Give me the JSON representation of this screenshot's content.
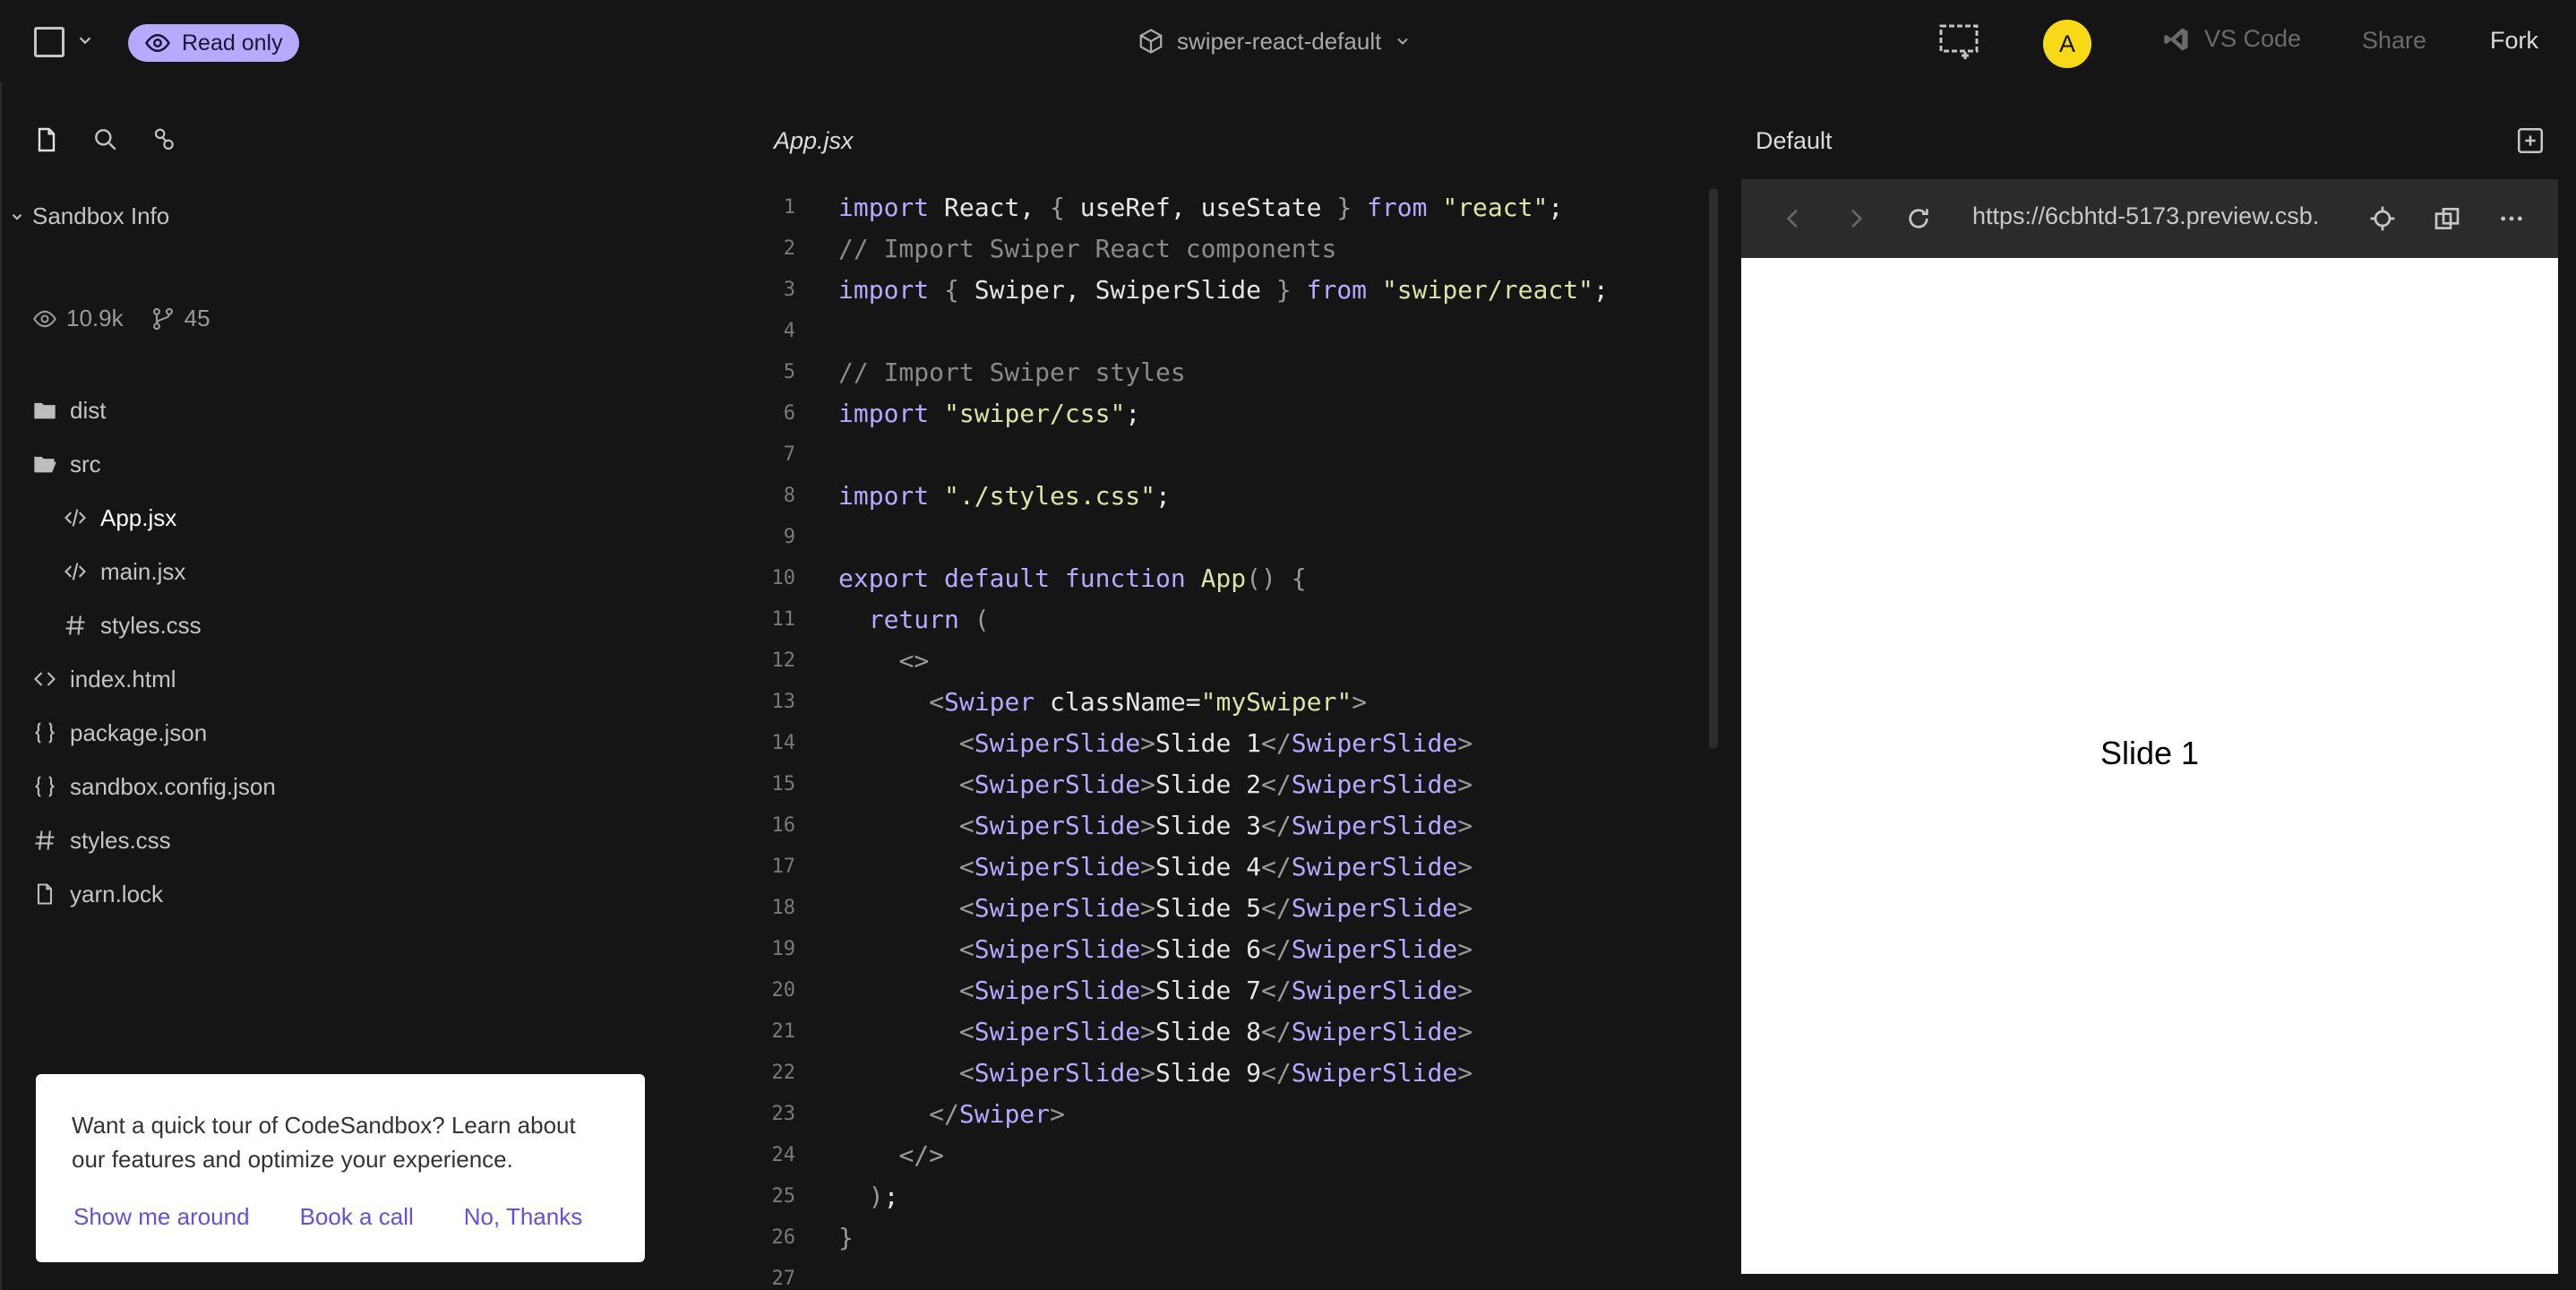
{
  "topbar": {
    "read_only_label": "Read only",
    "sandbox_name": "swiper-react-default",
    "avatar_initial": "A",
    "vscode_label": "VS Code",
    "share_label": "Share",
    "fork_label": "Fork",
    "readonly_bg": "#b8a9ff",
    "avatar_bg": "#f7d917"
  },
  "sidebar": {
    "section_title": "Sandbox Info",
    "views": "10.9k",
    "forks": "45",
    "tree": [
      {
        "name": "dist",
        "icon": "folder-icon",
        "level": 0
      },
      {
        "name": "src",
        "icon": "folder-open-icon",
        "level": 0
      },
      {
        "name": "App.jsx",
        "icon": "code-file-icon",
        "level": 1,
        "active": true
      },
      {
        "name": "main.jsx",
        "icon": "code-file-icon",
        "level": 1
      },
      {
        "name": "styles.css",
        "icon": "hash-icon",
        "level": 1
      },
      {
        "name": "index.html",
        "icon": "html-icon",
        "level": 0
      },
      {
        "name": "package.json",
        "icon": "json-icon",
        "level": 0
      },
      {
        "name": "sandbox.config.json",
        "icon": "json-icon",
        "level": 0
      },
      {
        "name": "styles.css",
        "icon": "hash-icon",
        "level": 0
      },
      {
        "name": "yarn.lock",
        "icon": "file-icon",
        "level": 0
      }
    ]
  },
  "tour": {
    "text": "Want a quick tour of CodeSandbox? Learn about our features and optimize your experience.",
    "show_me_around": "Show me around",
    "book_a_call": "Book a call",
    "no_thanks": "No, Thanks"
  },
  "editor": {
    "tab": "App.jsx",
    "lines": [
      [
        [
          "k",
          "import "
        ],
        [
          "a",
          "React, "
        ],
        [
          "p",
          "{ "
        ],
        [
          "a",
          "useRef, useState "
        ],
        [
          "p",
          "} "
        ],
        [
          "k",
          "from "
        ],
        [
          "s",
          "\"react\""
        ],
        [
          "a",
          ";"
        ]
      ],
      [
        [
          "c",
          "// Import Swiper React components"
        ]
      ],
      [
        [
          "k",
          "import "
        ],
        [
          "p",
          "{ "
        ],
        [
          "a",
          "Swiper, SwiperSlide "
        ],
        [
          "p",
          "} "
        ],
        [
          "k",
          "from "
        ],
        [
          "s",
          "\"swiper/react\""
        ],
        [
          "a",
          ";"
        ]
      ],
      [],
      [
        [
          "c",
          "// Import Swiper styles"
        ]
      ],
      [
        [
          "k",
          "import "
        ],
        [
          "s",
          "\"swiper/css\""
        ],
        [
          "a",
          ";"
        ]
      ],
      [],
      [
        [
          "k",
          "import "
        ],
        [
          "s",
          "\"./styles.css\""
        ],
        [
          "a",
          ";"
        ]
      ],
      [],
      [
        [
          "k",
          "export default function "
        ],
        [
          "f",
          "App"
        ],
        [
          "p",
          "() {"
        ]
      ],
      [
        [
          "a",
          "  "
        ],
        [
          "k",
          "return "
        ],
        [
          "p",
          "("
        ]
      ],
      [
        [
          "a",
          "    "
        ],
        [
          "p",
          "<>"
        ]
      ],
      [
        [
          "a",
          "      "
        ],
        [
          "p",
          "<"
        ],
        [
          "t",
          "Swiper "
        ],
        [
          "a",
          "className="
        ],
        [
          "s",
          "\"mySwiper\""
        ],
        [
          "p",
          ">"
        ]
      ],
      [
        [
          "a",
          "        "
        ],
        [
          "p",
          "<"
        ],
        [
          "t",
          "SwiperSlide"
        ],
        [
          "p",
          ">"
        ],
        [
          "a",
          "Slide 1"
        ],
        [
          "p",
          "</"
        ],
        [
          "t",
          "SwiperSlide"
        ],
        [
          "p",
          ">"
        ]
      ],
      [
        [
          "a",
          "        "
        ],
        [
          "p",
          "<"
        ],
        [
          "t",
          "SwiperSlide"
        ],
        [
          "p",
          ">"
        ],
        [
          "a",
          "Slide 2"
        ],
        [
          "p",
          "</"
        ],
        [
          "t",
          "SwiperSlide"
        ],
        [
          "p",
          ">"
        ]
      ],
      [
        [
          "a",
          "        "
        ],
        [
          "p",
          "<"
        ],
        [
          "t",
          "SwiperSlide"
        ],
        [
          "p",
          ">"
        ],
        [
          "a",
          "Slide 3"
        ],
        [
          "p",
          "</"
        ],
        [
          "t",
          "SwiperSlide"
        ],
        [
          "p",
          ">"
        ]
      ],
      [
        [
          "a",
          "        "
        ],
        [
          "p",
          "<"
        ],
        [
          "t",
          "SwiperSlide"
        ],
        [
          "p",
          ">"
        ],
        [
          "a",
          "Slide 4"
        ],
        [
          "p",
          "</"
        ],
        [
          "t",
          "SwiperSlide"
        ],
        [
          "p",
          ">"
        ]
      ],
      [
        [
          "a",
          "        "
        ],
        [
          "p",
          "<"
        ],
        [
          "t",
          "SwiperSlide"
        ],
        [
          "p",
          ">"
        ],
        [
          "a",
          "Slide 5"
        ],
        [
          "p",
          "</"
        ],
        [
          "t",
          "SwiperSlide"
        ],
        [
          "p",
          ">"
        ]
      ],
      [
        [
          "a",
          "        "
        ],
        [
          "p",
          "<"
        ],
        [
          "t",
          "SwiperSlide"
        ],
        [
          "p",
          ">"
        ],
        [
          "a",
          "Slide 6"
        ],
        [
          "p",
          "</"
        ],
        [
          "t",
          "SwiperSlide"
        ],
        [
          "p",
          ">"
        ]
      ],
      [
        [
          "a",
          "        "
        ],
        [
          "p",
          "<"
        ],
        [
          "t",
          "SwiperSlide"
        ],
        [
          "p",
          ">"
        ],
        [
          "a",
          "Slide 7"
        ],
        [
          "p",
          "</"
        ],
        [
          "t",
          "SwiperSlide"
        ],
        [
          "p",
          ">"
        ]
      ],
      [
        [
          "a",
          "        "
        ],
        [
          "p",
          "<"
        ],
        [
          "t",
          "SwiperSlide"
        ],
        [
          "p",
          ">"
        ],
        [
          "a",
          "Slide 8"
        ],
        [
          "p",
          "</"
        ],
        [
          "t",
          "SwiperSlide"
        ],
        [
          "p",
          ">"
        ]
      ],
      [
        [
          "a",
          "        "
        ],
        [
          "p",
          "<"
        ],
        [
          "t",
          "SwiperSlide"
        ],
        [
          "p",
          ">"
        ],
        [
          "a",
          "Slide 9"
        ],
        [
          "p",
          "</"
        ],
        [
          "t",
          "SwiperSlide"
        ],
        [
          "p",
          ">"
        ]
      ],
      [
        [
          "a",
          "      "
        ],
        [
          "p",
          "</"
        ],
        [
          "t",
          "Swiper"
        ],
        [
          "p",
          ">"
        ]
      ],
      [
        [
          "a",
          "    "
        ],
        [
          "p",
          "</>"
        ]
      ],
      [
        [
          "a",
          "  "
        ],
        [
          "p",
          ")"
        ],
        [
          "a",
          ";"
        ]
      ],
      [
        [
          "p",
          "}"
        ]
      ],
      []
    ]
  },
  "preview": {
    "title": "Default",
    "url": "https://6cbhtd-5173.preview.csb.",
    "slide_text": "Slide 1"
  }
}
